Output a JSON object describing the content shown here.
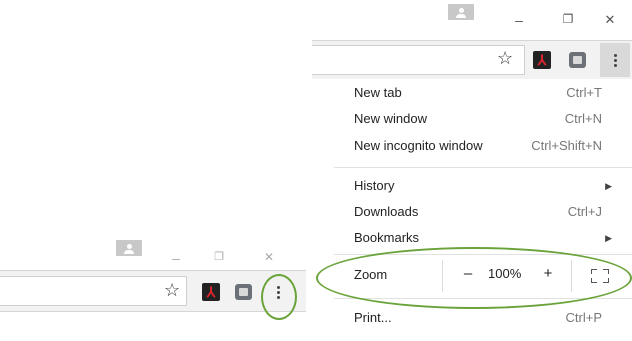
{
  "colors": {
    "highlight_green": "#6aa33a",
    "toolbar_bg": "#f2f2f2",
    "pdf_red": "#e0262c"
  },
  "window_controls": {
    "minimize": "–",
    "restore": "❐",
    "close": "✕"
  },
  "toolbar_icons": [
    "star-icon",
    "adobe-pdf-icon",
    "extension-icon",
    "chrome-menu-icon"
  ],
  "star_glyph": "☆",
  "pdf_glyph": "⅄",
  "menu": {
    "items_group1": [
      {
        "label": "New tab",
        "shortcut": "Ctrl+T"
      },
      {
        "label": "New window",
        "shortcut": "Ctrl+N"
      },
      {
        "label": "New incognito window",
        "shortcut": "Ctrl+Shift+N"
      }
    ],
    "items_group2": [
      {
        "label": "History",
        "shortcut": "",
        "submenu": "▶"
      },
      {
        "label": "Downloads",
        "shortcut": "Ctrl+J"
      },
      {
        "label": "Bookmarks",
        "shortcut": "",
        "submenu": "▶"
      }
    ],
    "zoom": {
      "label": "Zoom",
      "minus": "–",
      "value": "100%",
      "plus": "+"
    },
    "print": {
      "label": "Print...",
      "shortcut": "Ctrl+P"
    }
  }
}
